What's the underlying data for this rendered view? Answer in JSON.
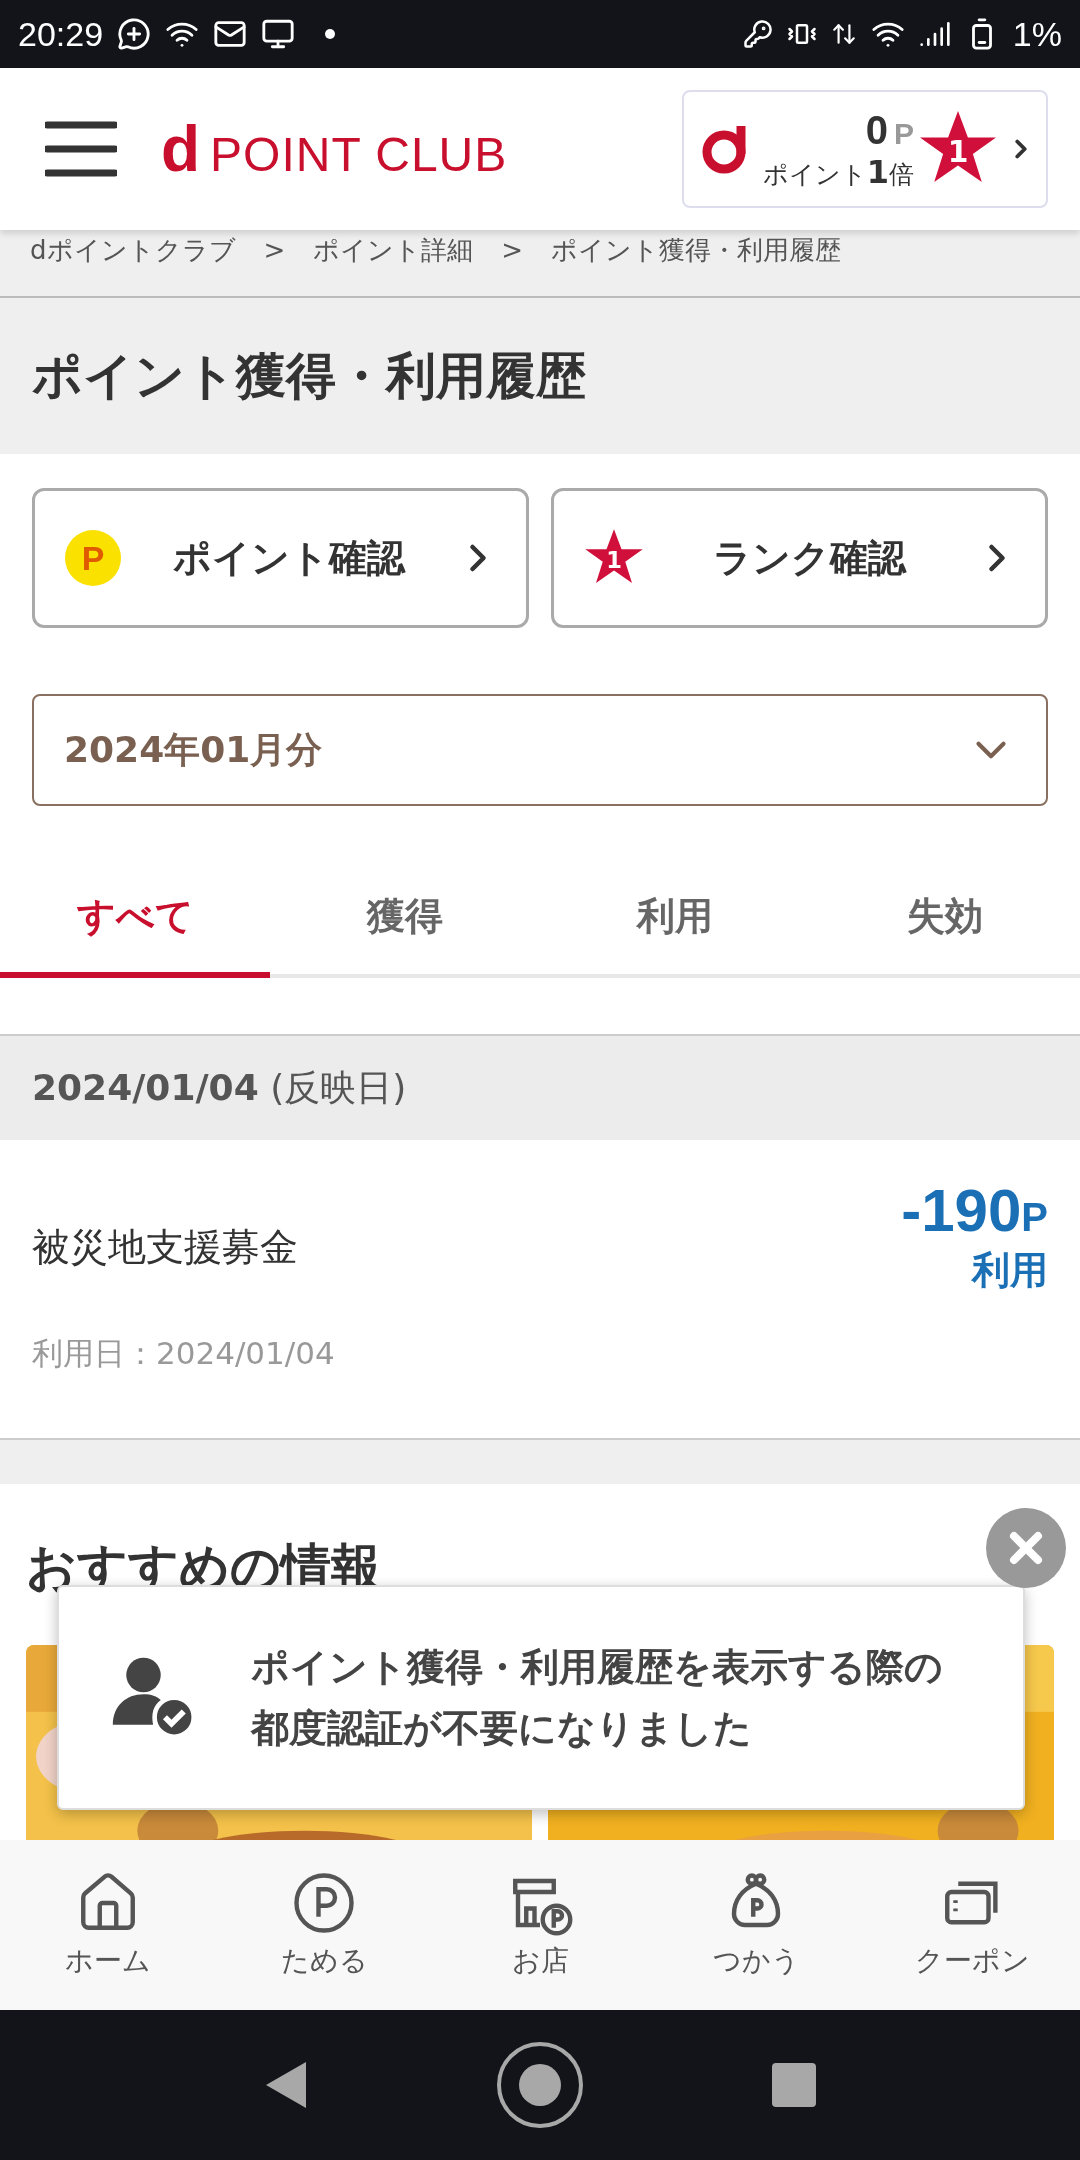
{
  "status_bar": {
    "time": "20:29",
    "battery": "1%"
  },
  "header": {
    "logo": {
      "mark": "d",
      "text": "POINT CLUB"
    },
    "points_card": {
      "points": "0",
      "unit": "P",
      "rate": "ポイント**1**倍",
      "rank": "1"
    }
  },
  "breadcrumb": {
    "items": [
      "dポイントクラブ",
      "ポイント詳細",
      "ポイント獲得・利用履歴"
    ],
    "separators": [
      ">",
      ">"
    ]
  },
  "page_title": "ポイント獲得・利用履歴",
  "shortcut_buttons": [
    {
      "kind": "points",
      "icon_text": "P",
      "label": "ポイント確認"
    },
    {
      "kind": "rank",
      "icon_text": "1",
      "label": "ランク確認"
    }
  ],
  "month_select": {
    "value": "2024年01月分"
  },
  "tabs": [
    {
      "label": "すべて",
      "selected": true
    },
    {
      "label": "獲得",
      "selected": false
    },
    {
      "label": "利用",
      "selected": false
    },
    {
      "label": "失効",
      "selected": false
    }
  ],
  "history": [
    {
      "date": "2024/01/04",
      "date_note": "(反映日)",
      "entries": [
        {
          "title": "被災地支援募金",
          "amount": "-190",
          "unit": "P",
          "type_label": "利用",
          "used_date": "利用日：2024/01/04"
        }
      ]
    }
  ],
  "recommend": {
    "title": "おすすめの情報"
  },
  "toast": {
    "message": "ポイント獲得・利用履歴を表示する際の都度認証が不要になりました"
  },
  "bottom_nav": [
    {
      "kind": "home",
      "label": "ホーム"
    },
    {
      "kind": "save",
      "label": "ためる"
    },
    {
      "kind": "store",
      "label": "お店"
    },
    {
      "kind": "use",
      "label": "つかう"
    },
    {
      "kind": "coupon",
      "label": "クーポン"
    }
  ]
}
